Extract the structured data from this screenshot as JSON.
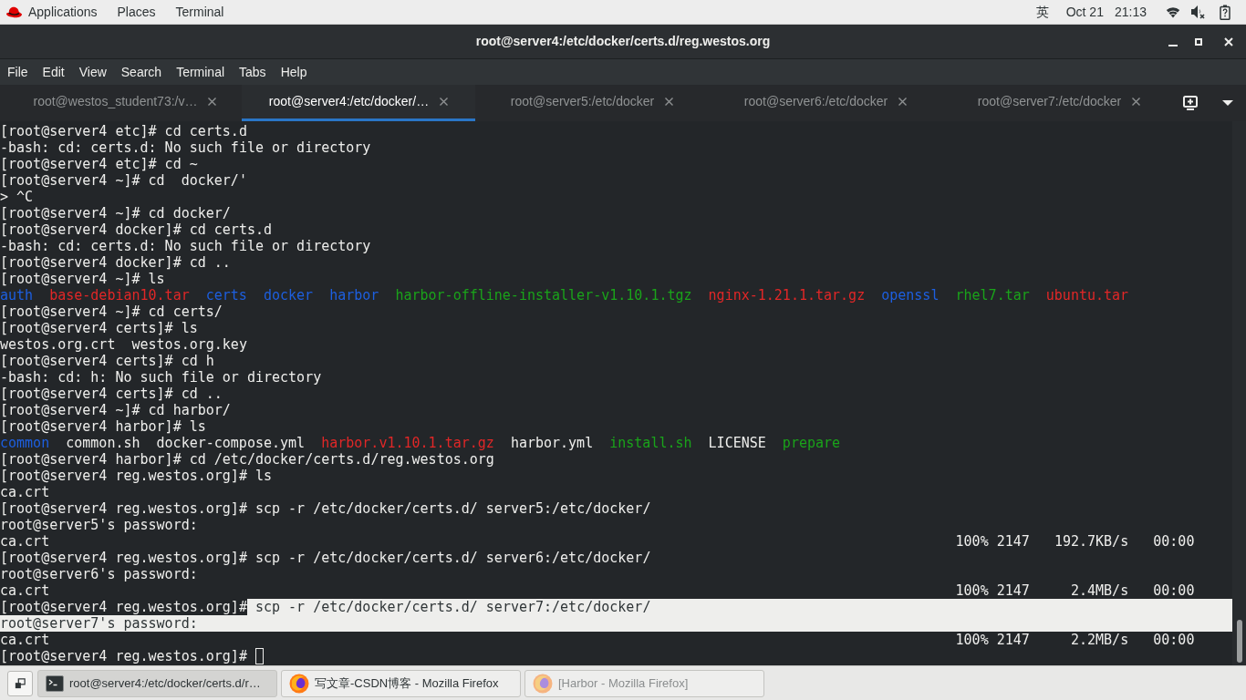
{
  "top_bar": {
    "menus": [
      "Applications",
      "Places",
      "Terminal"
    ],
    "input_method": "英",
    "date": "Oct 21",
    "time": "21:13",
    "volume_muted": true
  },
  "window": {
    "title": "root@server4:/etc/docker/certs.d/reg.westos.org"
  },
  "menu_bar": [
    "File",
    "Edit",
    "View",
    "Search",
    "Terminal",
    "Tabs",
    "Help"
  ],
  "tabs": [
    {
      "label": "root@westos_student73:/v…",
      "selected": false
    },
    {
      "label": "root@server4:/etc/docker/…",
      "selected": true
    },
    {
      "label": "root@server5:/etc/docker",
      "selected": false
    },
    {
      "label": "root@server6:/etc/docker",
      "selected": false
    },
    {
      "label": "root@server7:/etc/docker",
      "selected": false
    }
  ],
  "terminal": {
    "cursor": true,
    "lines": [
      {
        "kind": "prompt",
        "prompt": "[root@server4 etc]#",
        "command": "cd certs.d",
        "selected": false
      },
      {
        "kind": "output",
        "text": "-bash: cd: certs.d: No such file or directory",
        "selected": false
      },
      {
        "kind": "prompt",
        "prompt": "[root@server4 etc]#",
        "command": "cd ~",
        "selected": false
      },
      {
        "kind": "prompt",
        "prompt": "[root@server4 ~]#",
        "command": "cd  docker/'",
        "selected": false
      },
      {
        "kind": "output",
        "text": "> ^C",
        "selected": false
      },
      {
        "kind": "prompt",
        "prompt": "[root@server4 ~]#",
        "command": "cd docker/",
        "selected": false
      },
      {
        "kind": "prompt",
        "prompt": "[root@server4 docker]#",
        "command": "cd certs.d",
        "selected": false
      },
      {
        "kind": "output",
        "text": "-bash: cd: certs.d: No such file or directory",
        "selected": false
      },
      {
        "kind": "prompt",
        "prompt": "[root@server4 docker]#",
        "command": "cd ..",
        "selected": false
      },
      {
        "kind": "prompt",
        "prompt": "[root@server4 ~]#",
        "command": "ls",
        "selected": false
      },
      {
        "kind": "ls",
        "selected": false,
        "entries": [
          {
            "name": "auth",
            "color": "#1d5fe0"
          },
          {
            "name": "base-debian10.tar",
            "color": "#e12727"
          },
          {
            "name": "certs",
            "color": "#1d5fe0"
          },
          {
            "name": "docker",
            "color": "#1d5fe0"
          },
          {
            "name": "harbor",
            "color": "#1d5fe0"
          },
          {
            "name": "harbor-offline-installer-v1.10.1.tgz",
            "color": "#1aa31a"
          },
          {
            "name": "nginx-1.21.1.tar.gz",
            "color": "#e12727"
          },
          {
            "name": "openssl",
            "color": "#1d5fe0"
          },
          {
            "name": "rhel7.tar",
            "color": "#1aa31a"
          },
          {
            "name": "ubuntu.tar",
            "color": "#e12727"
          }
        ]
      },
      {
        "kind": "prompt",
        "prompt": "[root@server4 ~]#",
        "command": "cd certs/",
        "selected": false
      },
      {
        "kind": "prompt",
        "prompt": "[root@server4 certs]#",
        "command": "ls",
        "selected": false
      },
      {
        "kind": "ls",
        "selected": false,
        "entries": [
          {
            "name": "westos.org.crt",
            "color": "#eeeeec"
          },
          {
            "name": "westos.org.key",
            "color": "#eeeeec"
          }
        ]
      },
      {
        "kind": "prompt",
        "prompt": "[root@server4 certs]#",
        "command": "cd h",
        "selected": false
      },
      {
        "kind": "output",
        "text": "-bash: cd: h: No such file or directory",
        "selected": false
      },
      {
        "kind": "prompt",
        "prompt": "[root@server4 certs]#",
        "command": "cd ..",
        "selected": false
      },
      {
        "kind": "prompt",
        "prompt": "[root@server4 ~]#",
        "command": "cd harbor/",
        "selected": false
      },
      {
        "kind": "prompt",
        "prompt": "[root@server4 harbor]#",
        "command": "ls",
        "selected": false
      },
      {
        "kind": "ls",
        "selected": false,
        "entries": [
          {
            "name": "common",
            "color": "#1d5fe0"
          },
          {
            "name": "common.sh",
            "color": "#eeeeec"
          },
          {
            "name": "docker-compose.yml",
            "color": "#eeeeec"
          },
          {
            "name": "harbor.v1.10.1.tar.gz",
            "color": "#e12727"
          },
          {
            "name": "harbor.yml",
            "color": "#eeeeec"
          },
          {
            "name": "install.sh",
            "color": "#1aa31a"
          },
          {
            "name": "LICENSE",
            "color": "#eeeeec"
          },
          {
            "name": "prepare",
            "color": "#1aa31a"
          }
        ]
      },
      {
        "kind": "prompt",
        "prompt": "[root@server4 harbor]#",
        "command": "cd /etc/docker/certs.d/reg.westos.org",
        "selected": false
      },
      {
        "kind": "prompt",
        "prompt": "[root@server4 reg.westos.org]#",
        "command": "ls",
        "selected": false
      },
      {
        "kind": "output",
        "text": "ca.crt",
        "selected": false
      },
      {
        "kind": "prompt",
        "prompt": "[root@server4 reg.westos.org]#",
        "command": "scp -r /etc/docker/certs.d/ server5:/etc/docker/",
        "selected": false
      },
      {
        "kind": "output",
        "text": "root@server5's password:",
        "selected": false
      },
      {
        "kind": "transfer",
        "file": "ca.crt",
        "percent": "100%",
        "size": "2147",
        "rate": "192.7KB/s",
        "eta": "00:00",
        "selected": false
      },
      {
        "kind": "prompt",
        "prompt": "[root@server4 reg.westos.org]#",
        "command": "scp -r /etc/docker/certs.d/ server6:/etc/docker/",
        "selected": false
      },
      {
        "kind": "output",
        "text": "root@server6's password:",
        "selected": false
      },
      {
        "kind": "transfer",
        "file": "ca.crt",
        "percent": "100%",
        "size": "2147",
        "rate": "2.4MB/s",
        "eta": "00:00",
        "selected": false
      },
      {
        "kind": "prompt",
        "prompt": "[root@server4 reg.westos.org]#",
        "command": "scp -r /etc/docker/certs.d/ server7:/etc/docker/",
        "selected": true
      },
      {
        "kind": "output",
        "text": "root@server7's password:",
        "selected": true
      },
      {
        "kind": "transfer",
        "file": "ca.crt",
        "percent": "100%",
        "size": "2147",
        "rate": "2.2MB/s",
        "eta": "00:00",
        "selected": false
      },
      {
        "kind": "prompt",
        "prompt": "[root@server4 reg.westos.org]#",
        "selected": false
      }
    ]
  },
  "taskbar": {
    "tasks": [
      {
        "kind": "terminal",
        "label": "root@server4:/etc/docker/certs.d/r…",
        "selected": true,
        "minimized": false
      },
      {
        "kind": "browser",
        "label": "写文章-CSDN博客 - Mozilla Firefox",
        "selected": false,
        "minimized": false
      },
      {
        "kind": "browser",
        "label": "[Harbor - Mozilla Firefox]",
        "selected": false,
        "minimized": true
      }
    ]
  }
}
